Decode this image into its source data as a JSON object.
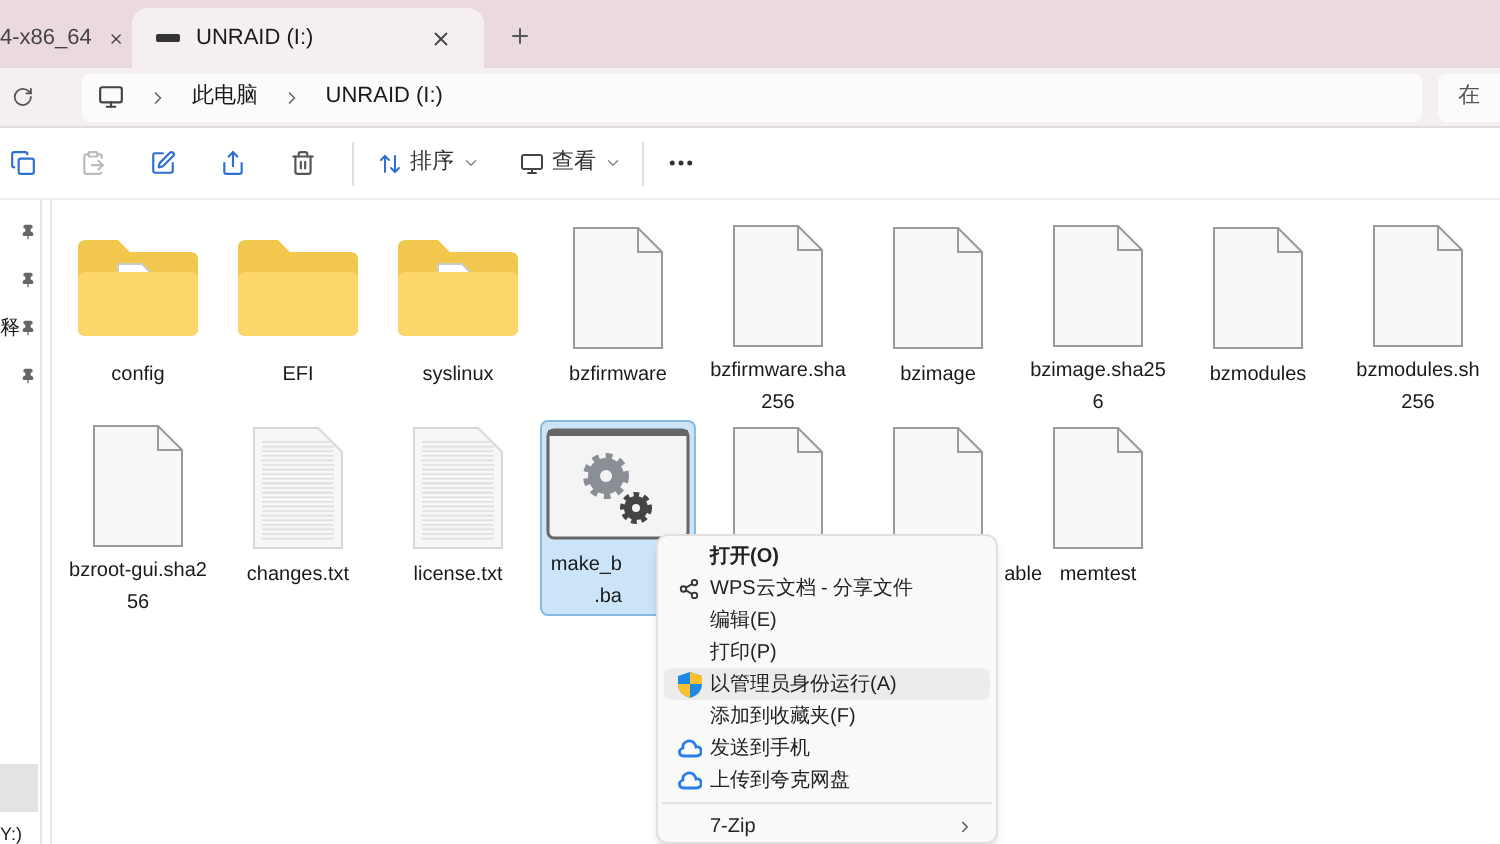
{
  "tabs": [
    {
      "title": "4-x86_64",
      "selected": false
    },
    {
      "title": "UNRAID (I:)",
      "selected": true
    }
  ],
  "address": {
    "crumbs": [
      "此电脑",
      "UNRAID (I:)"
    ],
    "search_placeholder": "在"
  },
  "toolbar": {
    "sort": "排序",
    "view": "查看"
  },
  "sidebar": {
    "items": [
      {
        "pinned": true
      },
      {
        "pinned": true
      },
      {
        "label": "释",
        "pinned": true
      },
      {
        "pinned": true
      }
    ],
    "drive_label": "Y:)"
  },
  "files": [
    {
      "kind": "folder",
      "lines": [
        "config"
      ],
      "selected": false
    },
    {
      "kind": "folder_empty",
      "lines": [
        "EFI"
      ],
      "selected": false
    },
    {
      "kind": "folder",
      "lines": [
        "syslinux"
      ],
      "selected": false
    },
    {
      "kind": "file",
      "lines": [
        "bzfirmware"
      ],
      "selected": false
    },
    {
      "kind": "file",
      "lines": [
        "bzfirmware.sha",
        "256"
      ],
      "selected": false
    },
    {
      "kind": "file",
      "lines": [
        "bzimage"
      ],
      "selected": false
    },
    {
      "kind": "file",
      "lines": [
        "bzimage.sha25",
        "6"
      ],
      "selected": false
    },
    {
      "kind": "file",
      "lines": [
        "bzmodules"
      ],
      "selected": false
    },
    {
      "kind": "file",
      "lines": [
        "bzmodules.sh",
        "256"
      ],
      "selected": false
    },
    {
      "kind": "file",
      "lines": [
        "bzroot-gui.sha2",
        "56"
      ],
      "selected": false
    },
    {
      "kind": "text",
      "lines": [
        "changes.txt"
      ],
      "selected": false
    },
    {
      "kind": "text",
      "lines": [
        "license.txt"
      ],
      "selected": false
    },
    {
      "kind": "batch",
      "lines": [
        "make_b",
        ".ba"
      ],
      "selected": true
    },
    {
      "kind": "file",
      "selected": false
    },
    {
      "kind": "file",
      "lines": [
        "able"
      ],
      "selected": false
    },
    {
      "kind": "file",
      "lines": [
        "memtest"
      ],
      "selected": false
    }
  ],
  "context_menu": [
    {
      "kind": "plain",
      "label": "打开(O)",
      "bold": true,
      "selected": false
    },
    {
      "kind": "share",
      "label": "WPS云文档 - 分享文件",
      "bold": false,
      "selected": false
    },
    {
      "kind": "plain",
      "label": "编辑(E)",
      "bold": false,
      "selected": false
    },
    {
      "kind": "plain",
      "label": "打印(P)",
      "bold": false,
      "selected": false
    },
    {
      "kind": "admin",
      "label": "以管理员身份运行(A)",
      "bold": false,
      "selected": true
    },
    {
      "kind": "plain",
      "label": "添加到收藏夹(F)",
      "bold": false,
      "selected": false
    },
    {
      "kind": "cloud",
      "label": "发送到手机",
      "bold": false,
      "selected": false
    },
    {
      "kind": "cloud",
      "label": "上传到夸克网盘",
      "bold": false,
      "selected": false
    },
    {
      "kind": "submenu",
      "label": "7-Zip",
      "bold": false,
      "selected": false
    }
  ]
}
